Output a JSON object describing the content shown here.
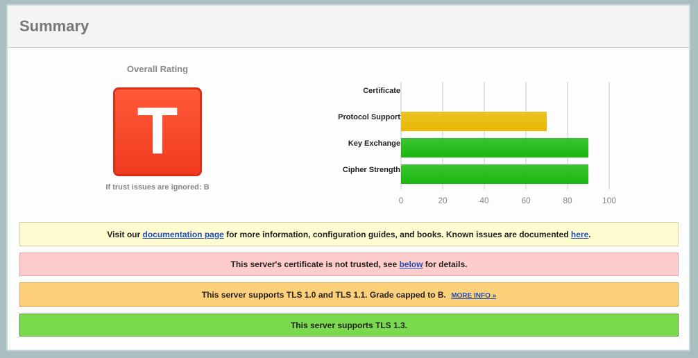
{
  "panel": {
    "title": "Summary"
  },
  "rating": {
    "label": "Overall Rating",
    "grade": "T",
    "ignored_note": "If trust issues are ignored: B",
    "grade_color": "#f03a20"
  },
  "chart_data": {
    "type": "bar",
    "orientation": "horizontal",
    "categories": [
      "Certificate",
      "Protocol Support",
      "Key Exchange",
      "Cipher Strength"
    ],
    "values": [
      0,
      70,
      90,
      90
    ],
    "bar_colors": [
      "#e8b800",
      "#e8b800",
      "#19b80f",
      "#19b80f"
    ],
    "xlim": [
      0,
      100
    ],
    "ticks": [
      "0",
      "20",
      "40",
      "60",
      "80",
      "100"
    ],
    "grid": true
  },
  "notices": {
    "doc": {
      "prefix": "Visit our ",
      "link1": "documentation page",
      "middle": " for more information, configuration guides, and books. Known issues are documented ",
      "link2": "here",
      "suffix": "."
    },
    "cert": {
      "prefix": "This server's certificate is not trusted, see ",
      "link": "below",
      "suffix": " for details."
    },
    "tls": {
      "text": "This server supports TLS 1.0 and TLS 1.1. Grade capped to B.",
      "link": "MORE INFO »"
    },
    "tls13": {
      "text": "This server supports TLS 1.3."
    }
  }
}
